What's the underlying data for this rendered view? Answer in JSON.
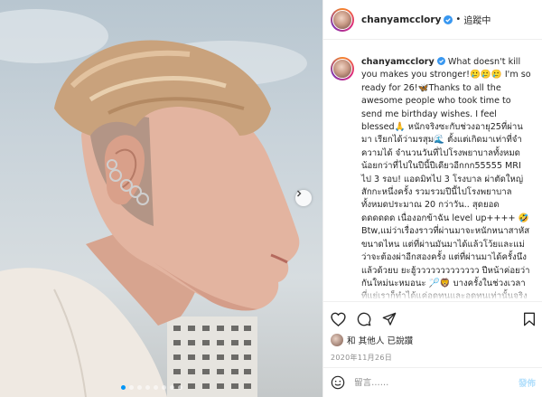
{
  "post": {
    "username": "chanyamcclory",
    "follow_status": "追蹤中",
    "caption_username": "chanyamcclory",
    "caption_text": "What doesn't kill you makes you stronger!🥲🥲🥲 I'm so ready for 26!🦋Thanks to all the awesome people who took time to send me birthday wishes. I feel blessed🙏 หนักจริงซะกับช่วงอายุ25ที่ผ่านมา เรียกได้ว่ามรสุม🌊 ตั้งแต่เกิดมาเท่าที่จำความได้ จำนวนวันที่ไปโรงพยาบาลทั้งหมด น้อยกว่าที่ไปในปีนี้ปีเดียวอีกกก55555 MRI ไป 3 รอบ! แอดมิทไป 3 โรงบาล ผ่าตัดใหญ่สักกะหนึ่งครั้ง รวมรวมปีนี้ไปโรงพยาบาลทั้งหมดประมาณ 20 กว่าวัน.. สุดยอดดดดดดด เนื่องอกข้าฉัน level up++++ 🤣 Btw,แม่ว่าเรื่องราวที่ผ่านมาจะหนักหนาสาหัสขนาดไหน แต่ที่ผ่านมันมาได้แล้วโว้ยและแม่ว่าจะต้องผ่าอีกสองครั้ง แต่ที่ผ่านมาได้ครั้งนึงแล้วด้วยบ ยะฮู้ววววววววววววว ปีหน้าค่อยว่ากันใหม่นะหมอนะ 🏸🦁 บางครั้งในช่วงเวลาที่แย่เราก็ทำได้แค่อดทนและอดทนเท่านั้นจริงจริง และมันจะมีช่วงเวลาที่ดีเสมอ"
  },
  "likes": {
    "text": "和 其他人 已說讚"
  },
  "date": "2020年11月26日",
  "comment": {
    "placeholder": "留言……",
    "post_label": "發佈"
  },
  "carousel": {
    "count": 8,
    "active_index": 0
  },
  "colors": {
    "verified": "#3897f0",
    "post_disabled": "#b2dffc",
    "dot_active": "#0095f6"
  }
}
